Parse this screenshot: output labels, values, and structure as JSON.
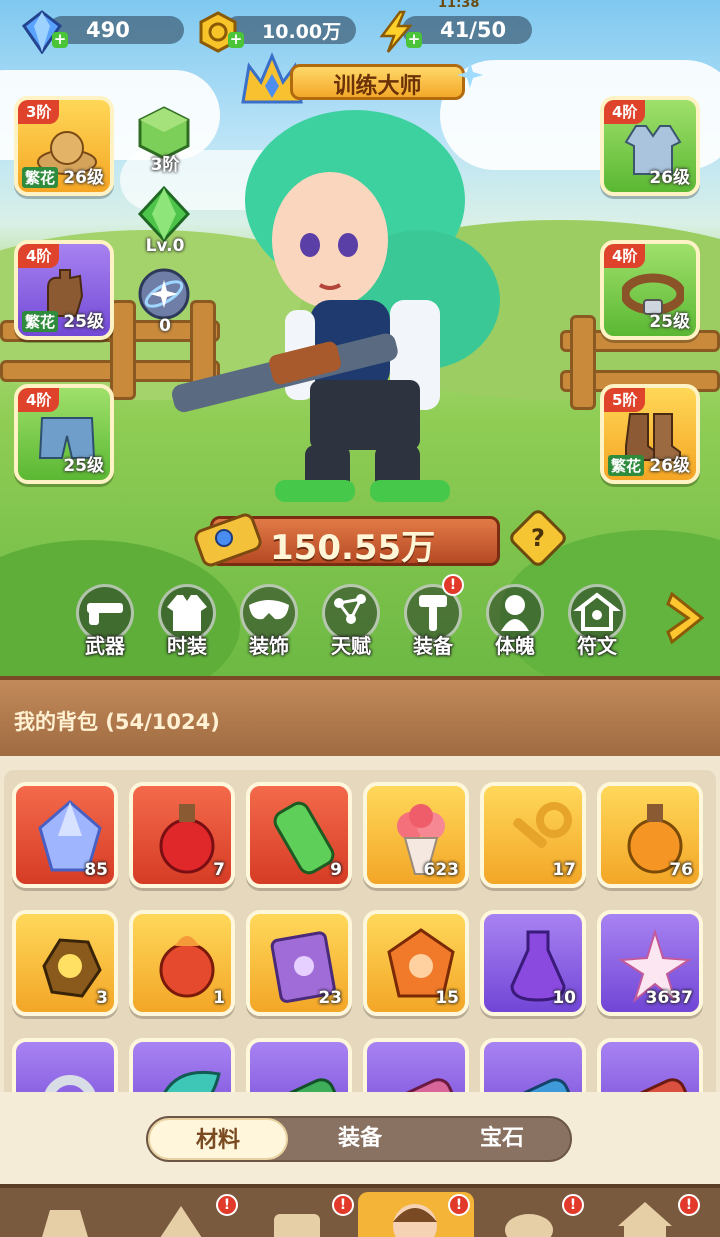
{
  "status": {
    "clock": "11:38"
  },
  "resources": [
    {
      "name": "diamond",
      "value": "490"
    },
    {
      "name": "gold",
      "value": "10.00万"
    },
    {
      "name": "energy",
      "value": "41/50"
    }
  ],
  "title": "训练大师",
  "left_slots": [
    {
      "tier": "3阶",
      "level": "26级",
      "tag": "繁花",
      "icon": "straw-hat-icon"
    },
    {
      "tier": "4阶",
      "level": "25级",
      "tag": "繁花",
      "icon": "glove-icon"
    },
    {
      "tier": "4阶",
      "level": "25级",
      "tag": "",
      "icon": "shorts-icon"
    }
  ],
  "right_slots": [
    {
      "tier": "4阶",
      "level": "26级",
      "tag": "",
      "icon": "vest-icon"
    },
    {
      "tier": "4阶",
      "level": "25级",
      "tag": "",
      "icon": "belt-icon"
    },
    {
      "tier": "5阶",
      "level": "26级",
      "tag": "繁花",
      "icon": "boots-icon"
    }
  ],
  "mini_stats": [
    {
      "icon": "green-cube-icon",
      "label": "3阶"
    },
    {
      "icon": "green-gem-icon",
      "label": "Lv.0"
    },
    {
      "icon": "orbit-star-icon",
      "label": "0"
    }
  ],
  "power": "150.55万",
  "functions": [
    {
      "label": "武器",
      "icon": "gun-icon",
      "alert": false
    },
    {
      "label": "时装",
      "icon": "jacket-icon",
      "alert": false
    },
    {
      "label": "装饰",
      "icon": "mask-icon",
      "alert": false
    },
    {
      "label": "天赋",
      "icon": "constellation-icon",
      "alert": false
    },
    {
      "label": "装备",
      "icon": "hammer-icon",
      "alert": true
    },
    {
      "label": "体魄",
      "icon": "spirit-icon",
      "alert": false
    },
    {
      "label": "符文",
      "icon": "rune-icon",
      "alert": false
    }
  ],
  "bag": {
    "title": "我的背包 (54/1024)"
  },
  "items": [
    {
      "icon": "blue-crystal-icon",
      "count": "85",
      "rarity": "red"
    },
    {
      "icon": "red-potion-icon",
      "count": "7",
      "rarity": "red"
    },
    {
      "icon": "green-canister-icon",
      "count": "9",
      "rarity": "red"
    },
    {
      "icon": "rose-bouquet-icon",
      "count": "623",
      "rarity": "gold"
    },
    {
      "icon": "gold-key-icon",
      "count": "17",
      "rarity": "gold"
    },
    {
      "icon": "orange-potion-icon",
      "count": "76",
      "rarity": "gold"
    },
    {
      "icon": "gold-ore-icon",
      "count": "3",
      "rarity": "gold"
    },
    {
      "icon": "red-flower-bud-icon",
      "count": "1",
      "rarity": "gold"
    },
    {
      "icon": "purple-book-icon",
      "count": "23",
      "rarity": "gold"
    },
    {
      "icon": "orange-gem-icon",
      "count": "15",
      "rarity": "gold"
    },
    {
      "icon": "purple-potion-icon",
      "count": "10",
      "rarity": "purple"
    },
    {
      "icon": "lily-flower-icon",
      "count": "3637",
      "rarity": "purple"
    },
    {
      "icon": "silver-ring-icon",
      "count": "",
      "rarity": "purple"
    },
    {
      "icon": "teal-leaf-icon",
      "count": "",
      "rarity": "purple"
    },
    {
      "icon": "green-scroll-icon",
      "count": "",
      "rarity": "purple"
    },
    {
      "icon": "pink-scroll-icon",
      "count": "",
      "rarity": "purple"
    },
    {
      "icon": "blue-scroll-icon",
      "count": "",
      "rarity": "purple"
    },
    {
      "icon": "red-scroll-icon",
      "count": "",
      "rarity": "purple"
    }
  ],
  "tabs": [
    {
      "label": "材料",
      "active": true
    },
    {
      "label": "装备",
      "active": false
    },
    {
      "label": "宝石",
      "active": false
    }
  ],
  "bottom_nav": [
    {
      "icon": "shop-icon",
      "alert": false
    },
    {
      "icon": "battle-icon",
      "alert": true
    },
    {
      "icon": "forge-icon",
      "alert": true
    },
    {
      "icon": "hero-icon",
      "alert": true,
      "active": true
    },
    {
      "icon": "pet-icon",
      "alert": true
    },
    {
      "icon": "home-icon",
      "alert": true
    }
  ],
  "colors": {
    "tier_badge": "#e0432b",
    "alert": "#e23a2a",
    "bag_header": "#a06b42"
  }
}
